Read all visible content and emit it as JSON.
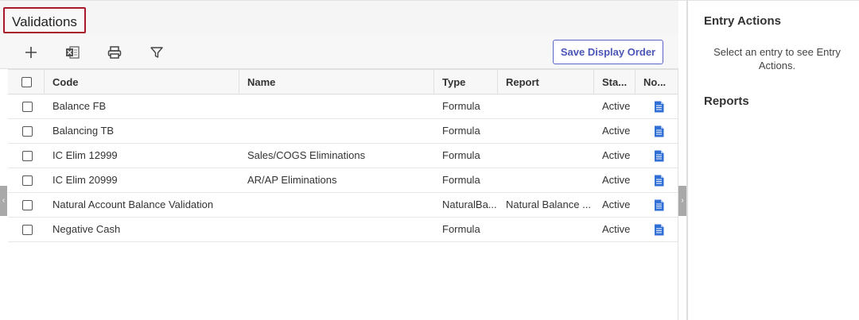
{
  "page": {
    "title": "Validations"
  },
  "toolbar": {
    "icons": [
      "add-icon",
      "excel-export-icon",
      "print-icon",
      "filter-icon"
    ],
    "save_display_order_label": "Save Display Order"
  },
  "table": {
    "columns": [
      "Code",
      "Name",
      "Type",
      "Report",
      "Sta...",
      "No..."
    ],
    "rows": [
      {
        "code": "Balance FB",
        "name": "",
        "type": "Formula",
        "report": "",
        "status": "Active"
      },
      {
        "code": "Balancing TB",
        "name": "",
        "type": "Formula",
        "report": "",
        "status": "Active"
      },
      {
        "code": "IC Elim 12999",
        "name": "Sales/COGS Eliminations",
        "type": "Formula",
        "report": "",
        "status": "Active"
      },
      {
        "code": "IC Elim 20999",
        "name": "AR/AP Eliminations",
        "type": "Formula",
        "report": "",
        "status": "Active"
      },
      {
        "code": "Natural Account Balance Validation",
        "name": "",
        "type": "NaturalBa...",
        "report": "Natural Balance ...",
        "status": "Active"
      },
      {
        "code": "Negative Cash",
        "name": "",
        "type": "Formula",
        "report": "",
        "status": "Active"
      }
    ]
  },
  "right_panel": {
    "entry_actions_title": "Entry Actions",
    "entry_actions_message": "Select an entry to see Entry Actions.",
    "reports_title": "Reports"
  },
  "colors": {
    "title_outline": "#a8182b",
    "accent": "#4a55b8",
    "doc_icon": "#2f6fd6"
  }
}
